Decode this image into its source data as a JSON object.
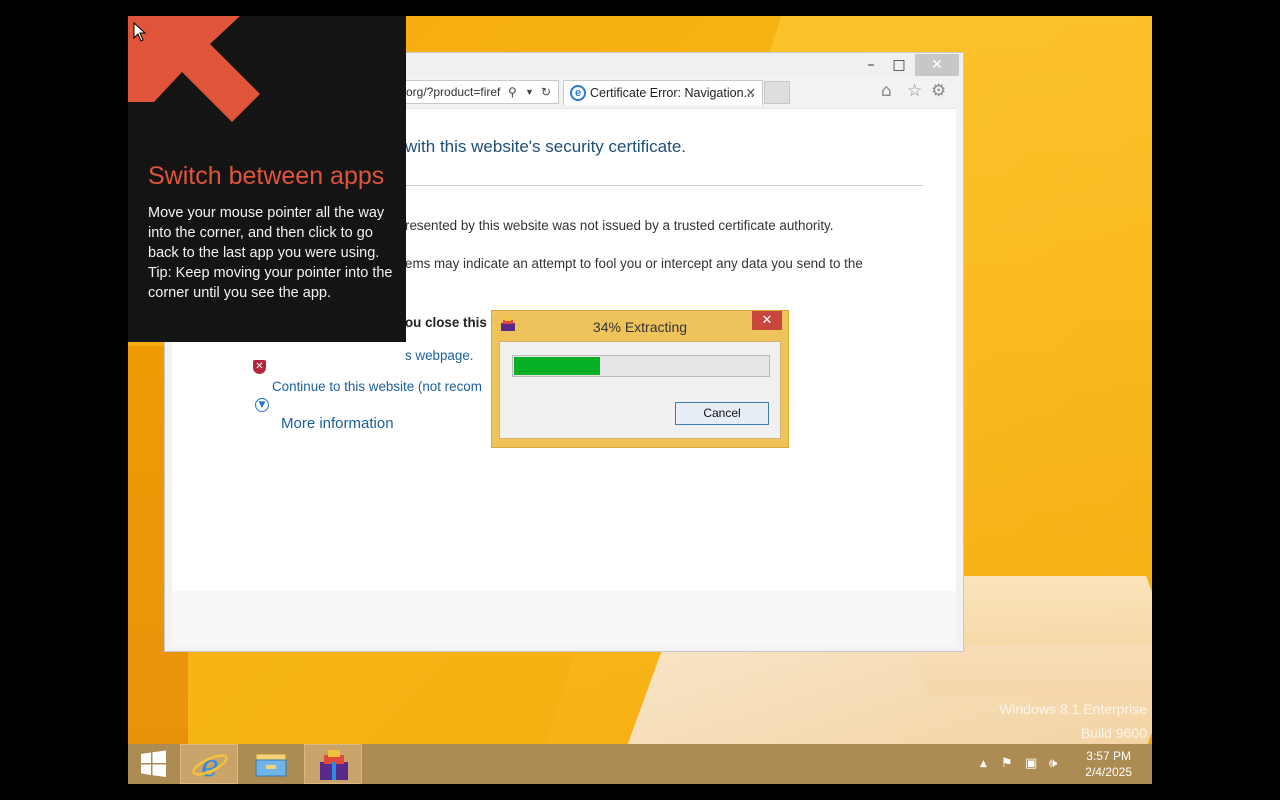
{
  "browser": {
    "address_text": "org/?product=firef",
    "tab_title": "Certificate Error: Navigation...",
    "tab_close": "✕",
    "window_controls": {
      "minimize": "–",
      "maximize": "□",
      "close": "✕"
    }
  },
  "page": {
    "heading": "with this website's security certificate.",
    "line1": "resented by this website was not issued by a trusted certificate authority.",
    "line2": "ems may indicate an attempt to fool you or intercept any data you send to the",
    "recommend": "ou close this webpage and do not continue to this website.",
    "close_link": "s webpage.",
    "continue_link": "Continue to this website (not recom",
    "more_info": "More information"
  },
  "tip": {
    "title": "Switch between apps",
    "body": "Move your mouse pointer all the way into the corner, and then click to go back to the last app you were using.",
    "tip_line": "Tip: Keep moving your pointer into the corner until you see the app."
  },
  "dialog": {
    "title": "34% Extracting",
    "progress": 0.34,
    "cancel_label": "Cancel",
    "close": "✕"
  },
  "watermark": {
    "line1": "Windows 8.1 Enterprise",
    "line2": "Build 9600"
  },
  "taskbar": {
    "time": "3:57 PM",
    "date": "2/4/2025",
    "start_icon": "windows-logo-icon",
    "apps": [
      "internet-explorer-icon",
      "file-explorer-icon",
      "winrar-icon"
    ]
  }
}
